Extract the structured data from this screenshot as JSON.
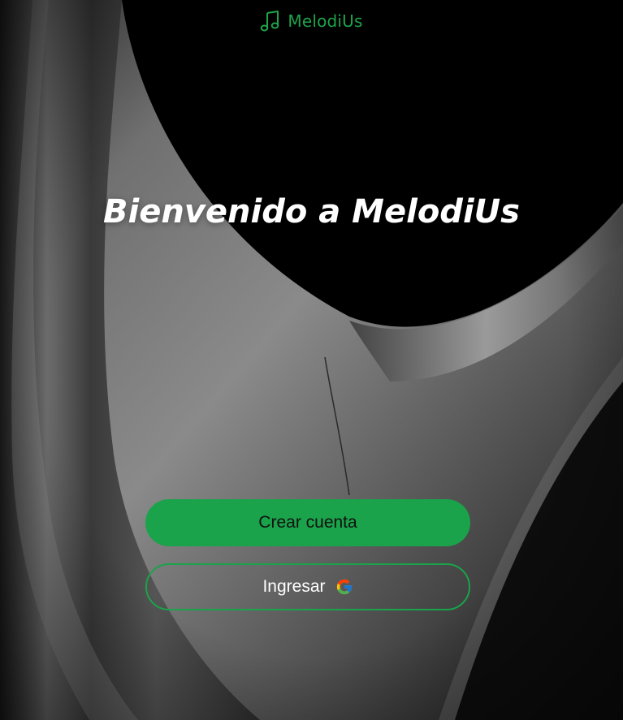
{
  "theme": {
    "accent": "#1ea44a",
    "accent_strong": "#1aa34a",
    "background": "#000000"
  },
  "brand": {
    "icon": "music-note-icon",
    "name": "MelodiUs"
  },
  "hero": {
    "title": "Bienvenido a MelodiUs"
  },
  "actions": {
    "create_account_label": "Crear cuenta",
    "login_label": "Ingresar",
    "login_icon": "google-icon"
  }
}
